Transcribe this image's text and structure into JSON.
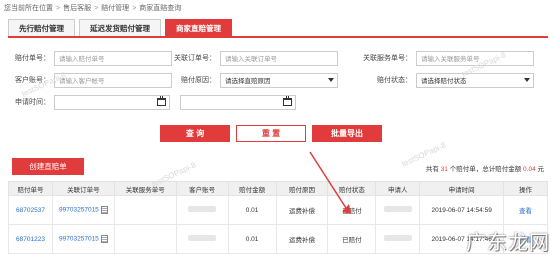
{
  "breadcrumb": [
    "您当前所在位置",
    "售后客服",
    "赔付管理",
    "商家直赔查询"
  ],
  "tabs": [
    "先行赔付管理",
    "延迟发货赔付管理",
    "商家直赔管理"
  ],
  "form": {
    "compensation_no": {
      "label": "赔付单号：",
      "placeholder": "请输入赔付单号"
    },
    "order_no": {
      "label": "关联订单号：",
      "placeholder": "请输入关联订单号"
    },
    "service_no": {
      "label": "关联服务单号：",
      "placeholder": "请输入关联服务单号"
    },
    "customer_account": {
      "label": "客户账号：",
      "placeholder": "请输入客户帐号"
    },
    "reason": {
      "label": "赔付原因：",
      "value": "请选择直赔原因"
    },
    "status": {
      "label": "赔付状态：",
      "value": "请选择赔付状态"
    },
    "apply_time": {
      "label": "申请时间："
    }
  },
  "buttons": {
    "query": "查 询",
    "reset": "重 置",
    "export": "批量导出",
    "create": "创建直赔单"
  },
  "summary": {
    "prefix": "共有",
    "count": "31",
    "mid": "个赔付单，总计赔付金额",
    "amount": "0.04",
    "suffix": "元"
  },
  "table": {
    "headers": [
      "赔付单号",
      "关联订单号",
      "关联服务单号",
      "客户账号",
      "赔付金额",
      "赔付原因",
      "赔付状态",
      "申请人",
      "申请时间",
      "操作"
    ],
    "rows": [
      {
        "id": "68702537",
        "order": "99703257015",
        "amount": "0.01",
        "reason": "运费补偿",
        "status": "已赔付",
        "time": "2019-06-07 14:54:59",
        "action": "查看"
      },
      {
        "id": "68701223",
        "order": "99703257015",
        "amount": "0.01",
        "reason": "运费补偿",
        "status": "已赔付",
        "time": "2019-06-07 14:17:46",
        "action": "查看"
      }
    ]
  },
  "watermark": "testSOPapi-8",
  "logo": "广东龙网",
  "colors": {
    "accent": "#e23b3b",
    "link": "#2a6fc9"
  }
}
